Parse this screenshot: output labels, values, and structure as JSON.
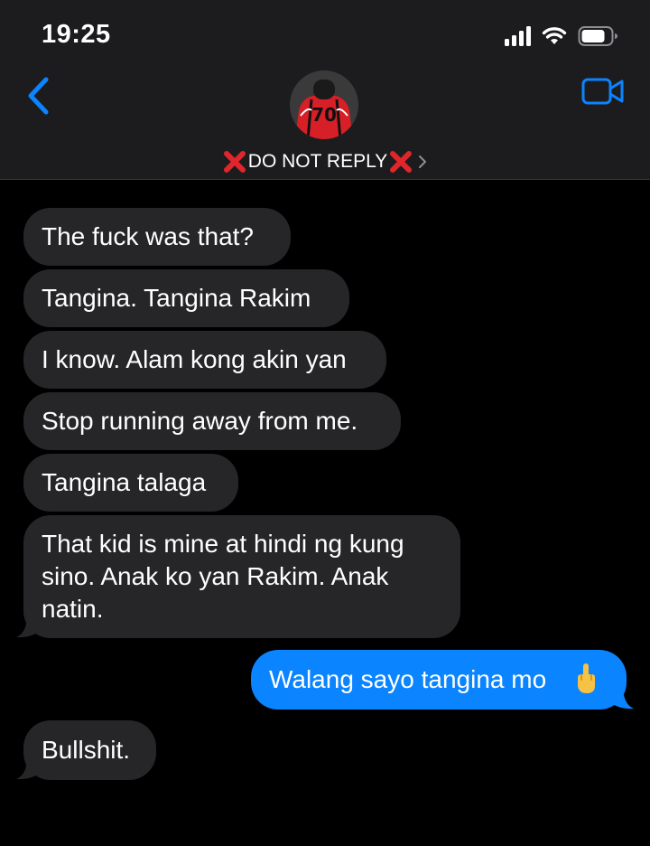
{
  "status_bar": {
    "time": "19:25",
    "icons": [
      "cellular-signal-icon",
      "wifi-icon",
      "battery-icon"
    ]
  },
  "header": {
    "back_icon": "chevron-left-icon",
    "video_icon": "facetime-video-icon",
    "avatar_text": "70",
    "contact_name": "DO NOT REPLY",
    "name_emoji": "cross-mark-emoji",
    "accent_color": "#0a84ff"
  },
  "messages": [
    {
      "direction": "incoming",
      "text": "The fuck was that?"
    },
    {
      "direction": "incoming",
      "text": "Tangina. Tangina Rakim"
    },
    {
      "direction": "incoming",
      "text": "I know. Alam kong akin yan"
    },
    {
      "direction": "incoming",
      "text": "Stop running away from me."
    },
    {
      "direction": "incoming",
      "text": "Tangina talaga"
    },
    {
      "direction": "incoming",
      "text": "That kid is mine at hindi ng kung\nsino. Anak ko yan Rakim. Anak\nnatin."
    },
    {
      "direction": "outgoing",
      "text": "Walang sayo tangina mo",
      "emoji": "middle-finger-emoji"
    },
    {
      "direction": "incoming",
      "text": "Bullshit."
    }
  ],
  "colors": {
    "header_bg": "#1c1c1e",
    "incoming_bubble": "#262628",
    "outgoing_bubble": "#0a84ff",
    "background": "#000000"
  }
}
